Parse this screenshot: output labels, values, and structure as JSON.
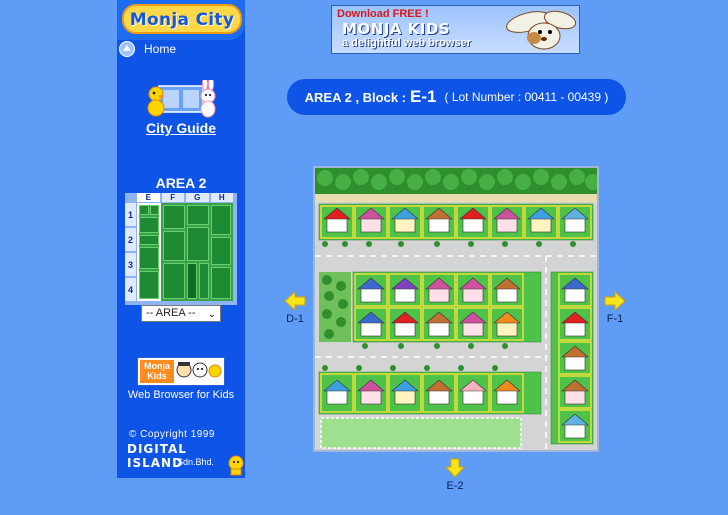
{
  "sidebar": {
    "logo": "Monja City",
    "home": "Home",
    "city_guide": "City Guide",
    "area_title": "AREA 2",
    "minimap": {
      "columns": [
        "E",
        "F",
        "G",
        "H"
      ],
      "rows": [
        "1",
        "2",
        "3",
        "4"
      ],
      "selected_column": "E"
    },
    "area_select": "-- AREA --",
    "kids_logo": "Monja Kids",
    "browser_caption": "Web Browser for Kids",
    "copyright": "© Copyright 1999",
    "company": "DIGITAL ISLAND",
    "company_suffix": "Sdn.Bhd."
  },
  "banner": {
    "download": "Download FREE !",
    "title": "MONJA KIDS",
    "tagline": "a delightful web browser"
  },
  "info": {
    "prefix": "AREA 2 , Block :",
    "block": "E-1",
    "lot": "( Lot Number : 00411 - 00439 )"
  },
  "nav": {
    "west": "D-1",
    "east": "F-1",
    "south": "E-2"
  },
  "colors": {
    "page_bg": "#5e9cf6",
    "sidebar_bg": "#0e54e6",
    "accent_yellow": "#ffd84a",
    "arrow_yellow": "#f5e51a"
  }
}
